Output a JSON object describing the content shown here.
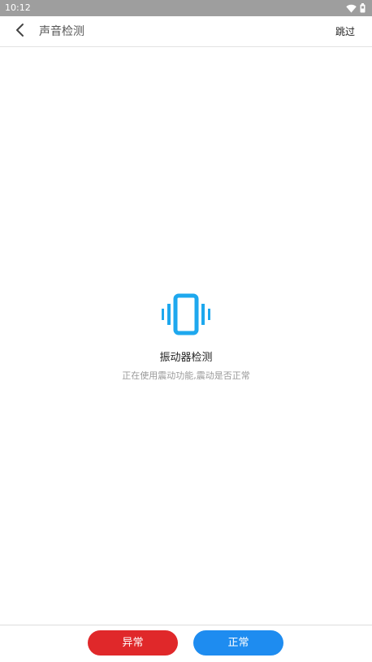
{
  "status_bar": {
    "time": "10:12",
    "icons": [
      "wifi-icon",
      "battery-icon"
    ]
  },
  "header": {
    "title": "声音检测",
    "skip_label": "跳过",
    "back_icon": "chevron-left-icon"
  },
  "main": {
    "icon": "vibrate-icon",
    "title": "振动器检测",
    "description": "正在使用震动功能,震动是否正常"
  },
  "footer": {
    "abnormal_label": "异常",
    "normal_label": "正常"
  },
  "colors": {
    "status_bar": "#9e9e9e",
    "accent_icon": "#1ea8ee",
    "abnormal": "#e0282a",
    "normal": "#1e8cf0"
  }
}
